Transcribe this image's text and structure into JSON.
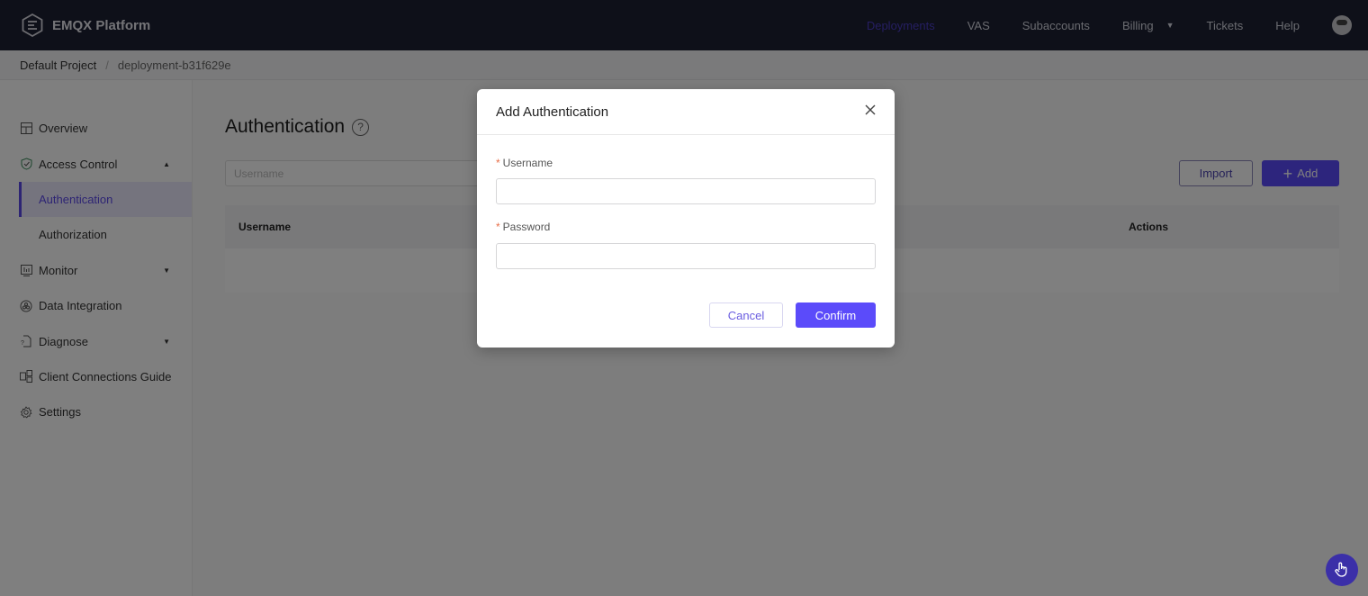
{
  "header": {
    "brand": "EMQX Platform",
    "nav": [
      {
        "label": "Deployments",
        "active": true
      },
      {
        "label": "VAS"
      },
      {
        "label": "Subaccounts"
      },
      {
        "label": "Billing",
        "dropdown": true
      },
      {
        "label": "Tickets"
      },
      {
        "label": "Help"
      }
    ]
  },
  "breadcrumb": {
    "root": "Default Project",
    "separator": "/",
    "current": "deployment-b31f629e"
  },
  "sidebar": {
    "items": [
      {
        "label": "Overview",
        "icon": "dashboard-icon"
      },
      {
        "label": "Access Control",
        "icon": "shield-check-icon",
        "expanded": true
      },
      {
        "label": "Authentication",
        "sub": true,
        "active": true
      },
      {
        "label": "Authorization",
        "sub": true
      },
      {
        "label": "Monitor",
        "icon": "monitor-chart-icon",
        "collapsed": true
      },
      {
        "label": "Data Integration",
        "icon": "integration-icon"
      },
      {
        "label": "Diagnose",
        "icon": "diagnose-file-icon",
        "collapsed": true
      },
      {
        "label": "Client Connections Guide",
        "icon": "connections-icon"
      },
      {
        "label": "Settings",
        "icon": "gear-icon"
      }
    ]
  },
  "main": {
    "title": "Authentication",
    "search_placeholder": "Username",
    "import_label": "Import",
    "add_label": "Add",
    "table": {
      "columns": [
        "Username",
        "Actions"
      ],
      "rows": []
    }
  },
  "modal": {
    "title": "Add Authentication",
    "fields": [
      {
        "label": "Username",
        "required": true,
        "value": ""
      },
      {
        "label": "Password",
        "required": true,
        "value": ""
      }
    ],
    "cancel_label": "Cancel",
    "confirm_label": "Confirm"
  },
  "colors": {
    "primary": "#5b4bfa",
    "nav_bg": "#1d2033",
    "required": "#e8704a"
  }
}
